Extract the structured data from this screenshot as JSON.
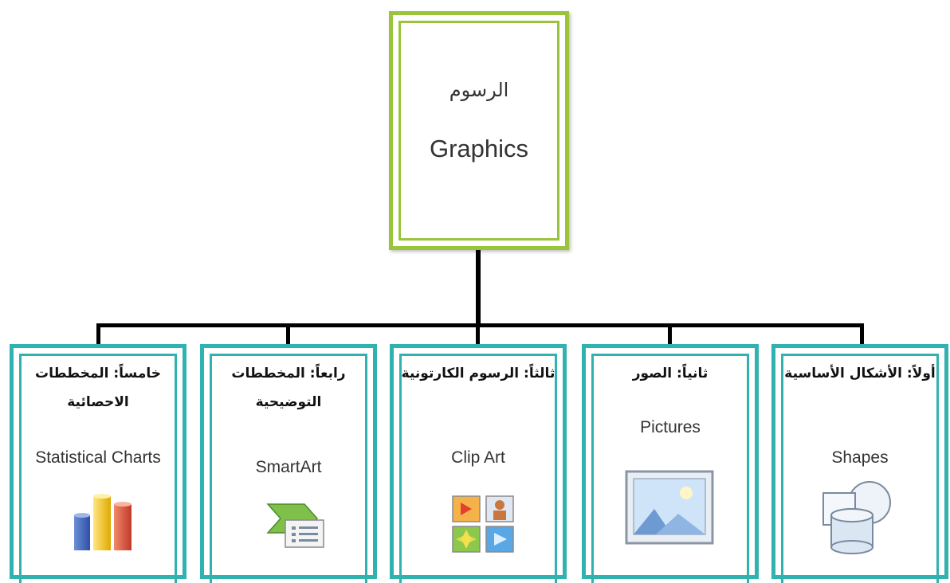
{
  "root": {
    "title_ar": "الرسوم",
    "title_en": "Graphics"
  },
  "children": [
    {
      "title_ar": "أولاً: الأشكال الأساسية",
      "title_en": "Shapes",
      "icon": "shapes-icon"
    },
    {
      "title_ar": "ثانياً: الصور",
      "title_en": "Pictures",
      "icon": "picture-icon"
    },
    {
      "title_ar": "ثالثاً: الرسوم الكارتونية",
      "title_en": "Clip Art",
      "icon": "clip-art-icon"
    },
    {
      "title_ar": "رابعاً: المخططات التوضيحية",
      "title_en": "SmartArt",
      "icon": "smartart-icon"
    },
    {
      "title_ar": "خامساً: المخططات الاحصائية",
      "title_en": "Statistical Charts",
      "icon": "bar-chart-icon"
    }
  ],
  "colors": {
    "root_border": "#9ac43a",
    "child_border": "#2fb2b0",
    "connector": "#000000"
  }
}
